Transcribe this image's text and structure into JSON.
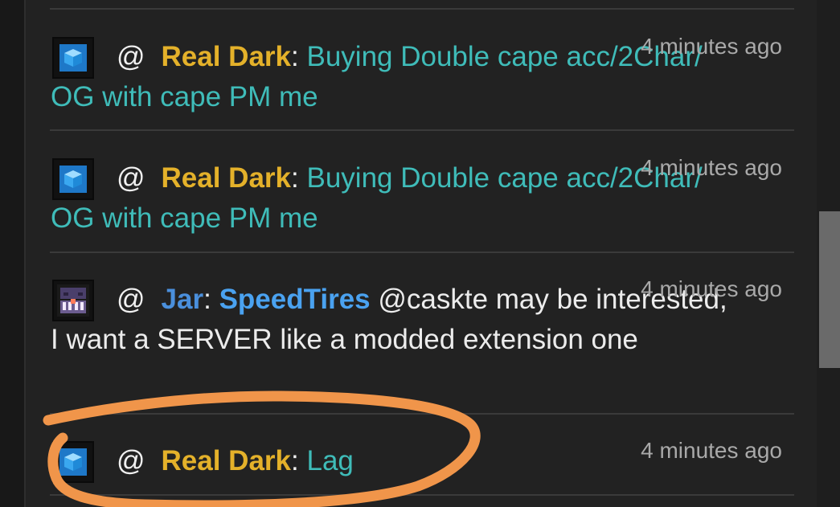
{
  "messages": [
    {
      "at": "@",
      "username": "Real Dark",
      "colon": ":",
      "body": "Buying Double cape acc/2Char/ OG with cape PM me",
      "timestamp": "4 minutes ago",
      "avatar": "cube-icon"
    },
    {
      "at": "@",
      "username": "Real Dark",
      "colon": ":",
      "body": "Buying Double cape acc/2Char/ OG with cape PM me",
      "timestamp": "4 minutes ago",
      "avatar": "cube-icon"
    },
    {
      "at": "@",
      "username": "Jar",
      "colon": ":",
      "mention": "SpeedTires",
      "body": "@caskte may be interested, I want a SERVER like a modded extension one",
      "timestamp": "4 minutes ago",
      "avatar": "pixel-character-icon"
    },
    {
      "at": "@",
      "username": "Real Dark",
      "colon": ":",
      "body": "Lag",
      "timestamp": "4 minutes ago",
      "avatar": "cube-icon"
    }
  ],
  "colors": {
    "background": "#222222",
    "username_gold": "#e4b12a",
    "username_blue": "#4a8fdc",
    "message_teal": "#3fbcb9",
    "timestamp": "#a9a9a9",
    "annotation_orange": "#f0954a"
  }
}
